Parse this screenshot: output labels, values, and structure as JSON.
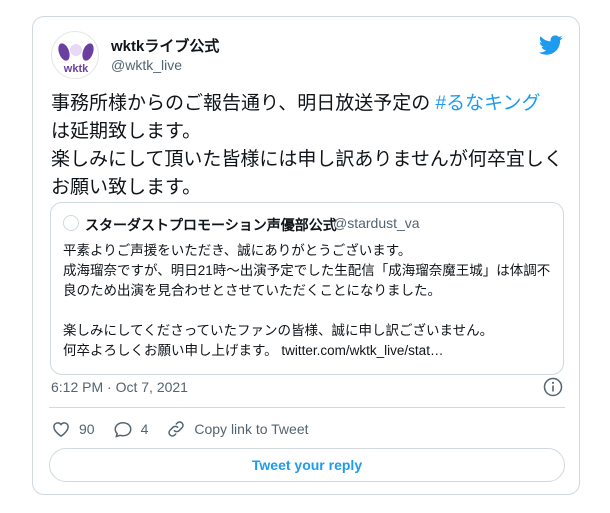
{
  "author": {
    "name": "wktkライブ公式",
    "handle": "@wktk_live",
    "avatar_text": "wktk"
  },
  "tweet": {
    "text_before": "事務所様からのご報告通り、明日放送予定の ",
    "hashtag": "#るなキング",
    "text_after": " は延期致します。\n楽しみにして頂いた皆様には申し訳ありませんが何卒宜しくお願い致します。"
  },
  "quote": {
    "name": "スターダストプロモーション声優部公式",
    "handle": "@stardust_va",
    "text": "平素よりご声援をいただき、誠にありがとうございます。\n成海瑠奈ですが、明日21時～出演予定でした生配信「成海瑠奈魔王城」は体調不良のため出演を見合わせとさせていただくことになりました。\n\n楽しみにしてくださっていたファンの皆様、誠に申し訳ございません。\n何卒よろしくお願い申し上げます。 twitter.com/wktk_live/stat…"
  },
  "timestamp": "6:12 PM · Oct 7, 2021",
  "actions": {
    "likes": "90",
    "replies": "4",
    "copy_link": "Copy link to Tweet"
  },
  "reply_button": "Tweet your reply",
  "colors": {
    "accent": "#1d9bf0",
    "secondary_text": "#536471",
    "border": "#cfd9de",
    "avatar_purple": "#6b3fa0"
  },
  "icons": [
    "twitter-bird-icon",
    "info-icon",
    "heart-icon",
    "reply-icon",
    "link-icon"
  ]
}
